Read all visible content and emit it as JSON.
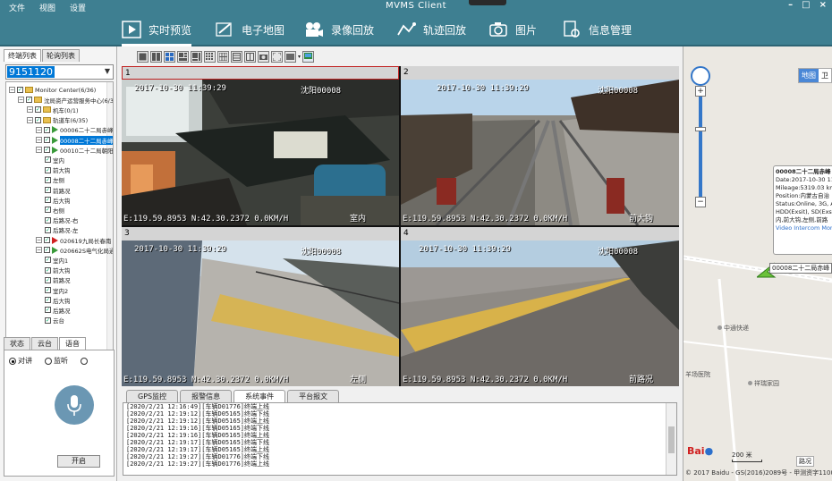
{
  "window": {
    "title": "MVMS Client",
    "menus": [
      "文件",
      "视图",
      "设置"
    ],
    "controls": [
      "–",
      "□",
      "×"
    ]
  },
  "nav": {
    "items": [
      {
        "label": "实时预览",
        "icon": "play-icon"
      },
      {
        "label": "电子地图",
        "icon": "map-pen-icon"
      },
      {
        "label": "录像回放",
        "icon": "video-camera-icon"
      },
      {
        "label": "轨迹回放",
        "icon": "route-icon"
      },
      {
        "label": "图片",
        "icon": "camera-icon"
      },
      {
        "label": "信息管理",
        "icon": "document-gear-icon"
      }
    ],
    "active_index": 0
  },
  "left": {
    "tabs": [
      "终端列表",
      "轮询列表"
    ],
    "search_value": "9151120",
    "tree": [
      {
        "label": "Monitor Center(6/36)",
        "indent": 0,
        "type": "root"
      },
      {
        "label": "沈局资产运营服务中心(6/36)",
        "indent": 1,
        "type": "folder"
      },
      {
        "label": "机车(0/1)",
        "indent": 2,
        "type": "folder"
      },
      {
        "label": "轨道车(6/35)",
        "indent": 2,
        "type": "folder"
      },
      {
        "label": "00006二十二局赤峰",
        "indent": 3,
        "type": "vehicle"
      },
      {
        "label": "00008二十二局赤峰",
        "indent": 3,
        "type": "vehicle",
        "selected": true
      },
      {
        "label": "00010二十二局朝阳",
        "indent": 3,
        "type": "vehicle"
      },
      {
        "label": "室内",
        "indent": 4,
        "type": "channel"
      },
      {
        "label": "前大钩",
        "indent": 4,
        "type": "channel"
      },
      {
        "label": "左侧",
        "indent": 4,
        "type": "channel"
      },
      {
        "label": "前路况",
        "indent": 4,
        "type": "channel"
      },
      {
        "label": "后大钩",
        "indent": 4,
        "type": "channel"
      },
      {
        "label": "右侧",
        "indent": 4,
        "type": "channel"
      },
      {
        "label": "后路况-右",
        "indent": 4,
        "type": "channel"
      },
      {
        "label": "后路况-左",
        "indent": 4,
        "type": "channel"
      },
      {
        "label": "020619九局长春南",
        "indent": 3,
        "type": "vehicle-red"
      },
      {
        "label": "020662S电气化局通",
        "indent": 3,
        "type": "vehicle"
      },
      {
        "label": "室内1",
        "indent": 4,
        "type": "channel"
      },
      {
        "label": "前大钩",
        "indent": 4,
        "type": "channel"
      },
      {
        "label": "前路况",
        "indent": 4,
        "type": "channel"
      },
      {
        "label": "室内2",
        "indent": 4,
        "type": "channel"
      },
      {
        "label": "后大钩",
        "indent": 4,
        "type": "channel"
      },
      {
        "label": "后路况",
        "indent": 4,
        "type": "channel"
      },
      {
        "label": "云台",
        "indent": 4,
        "type": "channel"
      }
    ],
    "bottom_tabs": [
      "状态",
      "云台",
      "语音"
    ],
    "bottom_active": 2,
    "radios": [
      "对讲",
      "监听",
      ""
    ],
    "start_button": "开启"
  },
  "grid": {
    "cells": [
      {
        "num": "1",
        "osd_time": "2017-10-30 11:39:29",
        "osd_name": "沈阳00008",
        "osd_gps": "E:119.59.8953 N:42.30.2372 0.0KM/H",
        "osd_chan": "室内"
      },
      {
        "num": "2",
        "osd_time": "2017-10-30 11:39:29",
        "osd_name": "沈阳00008",
        "osd_gps": "E:119.59.8953 N:42.30.2372 0.0KM/H",
        "osd_chan": "前大钩"
      },
      {
        "num": "3",
        "osd_time": "2017-10-30 11:39:29",
        "osd_name": "沈阳00008",
        "osd_gps": "E:119.59.8953 N:42.30.2372 0.0KM/H",
        "osd_chan": "左侧"
      },
      {
        "num": "4",
        "osd_time": "2017-10-30 11:39:29",
        "osd_name": "沈阳00008",
        "osd_gps": "E:119.59.8953 N:42.30.2372 0.0KM/H",
        "osd_chan": "前路况"
      }
    ]
  },
  "log": {
    "tabs": [
      "GPS监控",
      "报警信息",
      "系统事件",
      "平台报文"
    ],
    "active_tab": 2,
    "lines": [
      "[2020/2/21 12:16:49][车辆D01776]终端上线",
      "[2020/2/21 12:19:12][车辆D05165]终端下线",
      "[2020/2/21 12:19:12][车辆D05165]终端上线",
      "[2020/2/21 12:19:16][车辆D05165]终端下线",
      "[2020/2/21 12:19:16][车辆D05165]终端上线",
      "[2020/2/21 12:19:17][车辆D05165]终端下线",
      "[2020/2/21 12:19:17][车辆D05165]终端上线",
      "[2020/2/21 12:19:27][车辆D01776]终端下线",
      "[2020/2/21 12:19:27][车辆D01776]终端上线"
    ]
  },
  "map": {
    "type_buttons": [
      "地图",
      "卫"
    ],
    "popup": {
      "line1": "00008二十二局赤峰",
      "line2": "Date:2017-10-30 11:",
      "line3": "Mileage:5319.03 km",
      "line4": "Position:内蒙古自治",
      "line5": "Status:Online, 3G, A",
      "line6": "HDD(Exsit), SD(Exsit",
      "line7": "内,前大钩,左侧,前路",
      "links": "Video  Intercom  Moni"
    },
    "vehicle_label": "00008二十二局赤峰",
    "pois": [
      "中通快递",
      "羊场医院",
      "祥瑞家园"
    ],
    "scale": "200 米",
    "traffic": "路况",
    "copyright": "© 2017 Baidu - GS(2016)2089号 - 甲测资字1100930",
    "baidu_logo": "Bai",
    "colors": {
      "nav_bg": "#3e7f91",
      "accent": "#0078d7"
    }
  }
}
